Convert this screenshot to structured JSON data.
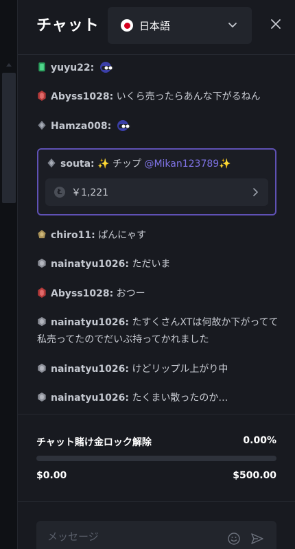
{
  "header": {
    "title": "チャット",
    "language": {
      "selected": "日本語"
    }
  },
  "messages": [
    {
      "user": "yuyu22:",
      "text": "",
      "badge": "green-gem",
      "emote": "goggles-emote"
    },
    {
      "user": "Abyss1028:",
      "text": "いくら売ったらあんな下がるねん",
      "badge": "red-gem"
    },
    {
      "user": "Hamza008:",
      "text": "",
      "badge": "gray-diamond",
      "emote": "goggles-emote"
    },
    {
      "user": "chiro11:",
      "text": "ぱんにゃす",
      "badge": "gold-pentagon"
    },
    {
      "user": "nainatyu1026:",
      "text": "ただいま",
      "badge": "silver-hexagon"
    },
    {
      "user": "Abyss1028:",
      "text": "おつー",
      "badge": "red-gem"
    },
    {
      "user": "nainatyu1026:",
      "text": "たすくさんXTは何故か下がってて私売ってたのでだいぶ持ってかれました",
      "badge": "silver-hexagon"
    },
    {
      "user": "nainatyu1026:",
      "text": "けどリップル上がり中",
      "badge": "silver-hexagon"
    },
    {
      "user": "nainatyu1026:",
      "text": "たくまい散ったのか…",
      "badge": "silver-hexagon"
    }
  ],
  "tip": {
    "user": "souta:",
    "sparkle": "✨",
    "label": "チップ",
    "mention": "@Mikan123789",
    "coin_icon": "litecoin-icon",
    "amount": "￥1,221"
  },
  "wager": {
    "title": "チャット賭け金ロック解除",
    "percent": "0.00%",
    "progress": 0.0,
    "min": "$0.00",
    "max": "$500.00"
  },
  "composer": {
    "placeholder": "メッセージ"
  },
  "colors": {
    "accent": "#7f73e6",
    "tip_border": "#5f51b5",
    "background": "#181a20"
  }
}
